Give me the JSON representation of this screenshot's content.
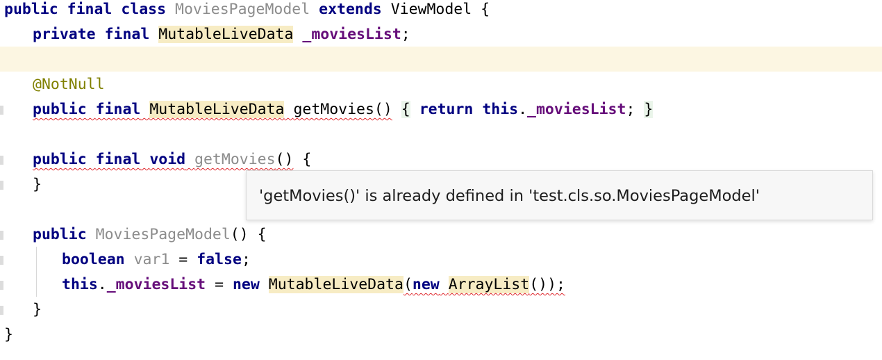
{
  "editor": {
    "line1": {
      "kw_public": "public",
      "kw_final": "final",
      "kw_class": "class",
      "class_name": "MoviesPageModel",
      "kw_extends": "extends",
      "parent_type": "ViewModel",
      "open_brace": "{"
    },
    "line2": {
      "kw_private": "private",
      "kw_final": "final",
      "type": "MutableLiveData",
      "field": "_moviesList",
      "semi": ";"
    },
    "line3": {
      "annotation": "@NotNull"
    },
    "line4": {
      "kw_public": "public",
      "kw_final": "final",
      "type": "MutableLiveData",
      "method": "getMovies()",
      "open_brace": "{",
      "kw_return": "return",
      "kw_this": "this",
      "dot": ".",
      "field": "_moviesList",
      "semi": ";",
      "close_brace": "}"
    },
    "line5": {
      "kw_public": "public",
      "kw_final": "final",
      "kw_void": "void",
      "method": "getMovies",
      "parens": "()",
      "open_brace": "{"
    },
    "line6": {
      "close_brace": "}"
    },
    "line7": {
      "kw_public": "public",
      "ctor_name": "MoviesPageModel",
      "parens_brace": "() {"
    },
    "line8": {
      "kw_boolean": "boolean",
      "var": "var1",
      "equals": "=",
      "kw_false": "false",
      "semi": ";"
    },
    "line9": {
      "kw_this": "this",
      "dot": ".",
      "field": "_moviesList",
      "equals": "=",
      "kw_new": "new",
      "type": "MutableLiveData",
      "open_paren": "(",
      "kw_new2": "new",
      "arraylist": "ArrayList",
      "tail": "());"
    },
    "line10": {
      "close_brace": "}"
    },
    "line11": {
      "close_brace": "}"
    }
  },
  "tooltip": {
    "message": "'getMovies()' is already defined in 'test.cls.so.MoviesPageModel'"
  }
}
